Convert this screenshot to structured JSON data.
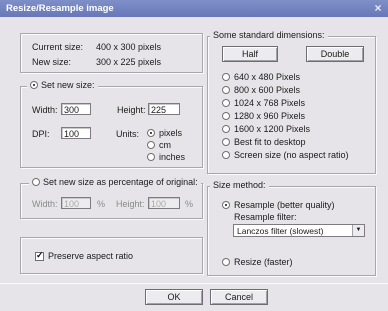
{
  "window": {
    "title": "Resize/Resample image",
    "close_glyph": "×"
  },
  "info": {
    "current_label": "Current size:",
    "current_value": "400 x 300 pixels",
    "new_label": "New size:",
    "new_value": "300 x 225 pixels"
  },
  "set_new_size": {
    "label": "Set new size:",
    "selected": true,
    "width_label": "Width:",
    "width_value": "300",
    "height_label": "Height:",
    "height_value": "225",
    "dpi_label": "DPI:",
    "dpi_value": "100",
    "units_label": "Units:",
    "units": [
      {
        "label": "pixels",
        "selected": true
      },
      {
        "label": "cm",
        "selected": false
      },
      {
        "label": "inches",
        "selected": false
      }
    ]
  },
  "percentage": {
    "label": "Set new size as percentage of original:",
    "selected": false,
    "width_label": "Width:",
    "width_value": "100",
    "height_label": "Height:",
    "height_value": "100",
    "unit": "%"
  },
  "aspect": {
    "label": "Preserve aspect ratio",
    "checked": true
  },
  "standard": {
    "title": "Some standard dimensions:",
    "half_label": "Half",
    "double_label": "Double",
    "options": [
      "640 x 480 Pixels",
      "800 x 600 Pixels",
      "1024 x 768 Pixels",
      "1280 x 960 Pixels",
      "1600 x 1200 Pixels",
      "Best fit to desktop",
      "Screen size (no aspect ratio)"
    ]
  },
  "method": {
    "title": "Size method:",
    "resample_label": "Resample (better quality)",
    "resample_selected": true,
    "filter_label": "Resample filter:",
    "filter_value": "Lanczos filter (slowest)",
    "resize_label": "Resize (faster)",
    "resize_selected": false
  },
  "buttons": {
    "ok": "OK",
    "cancel": "Cancel"
  }
}
